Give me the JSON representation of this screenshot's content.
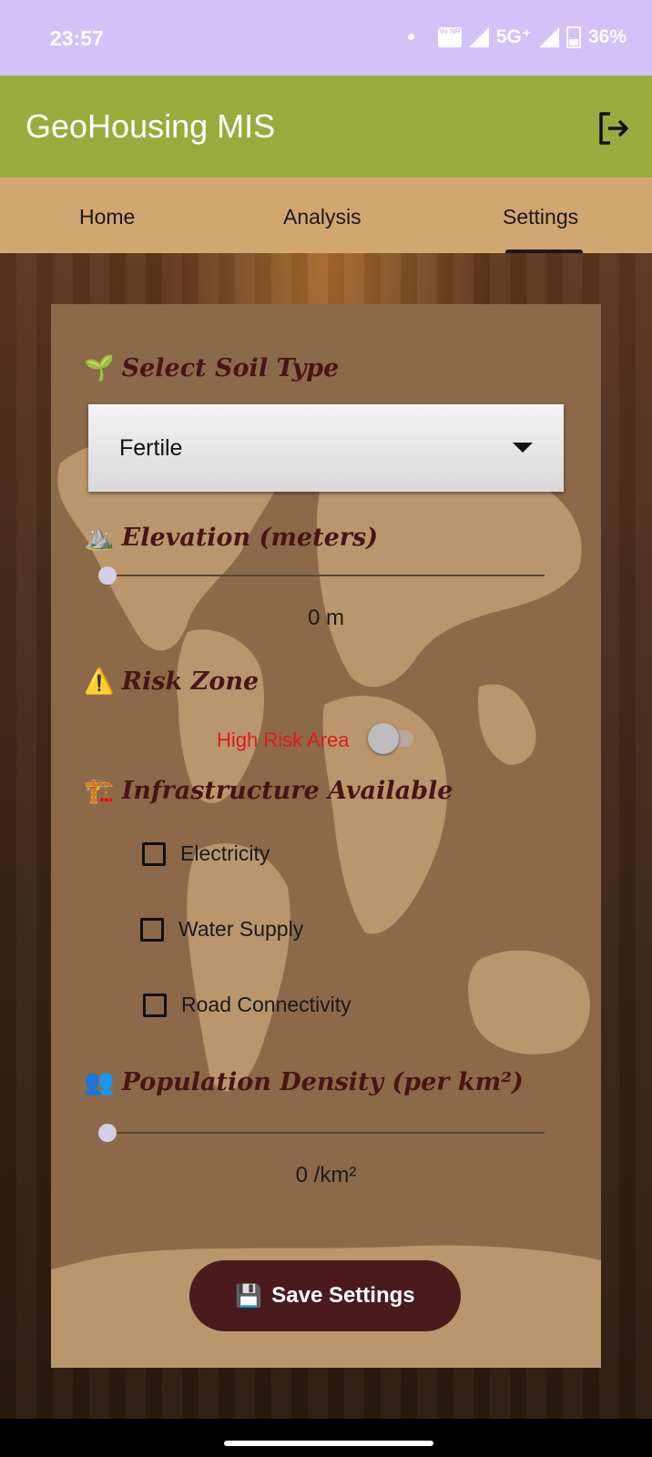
{
  "status": {
    "time": "23:57",
    "network": "5G⁺",
    "battery": "36%",
    "volte": "Vo NR"
  },
  "app": {
    "title": "GeoHousing MIS",
    "logout_icon": "logout-icon",
    "header_color": "#9aab3e"
  },
  "tabs": [
    {
      "label": "Home",
      "selected": false
    },
    {
      "label": "Analysis",
      "selected": false
    },
    {
      "label": "Settings",
      "selected": true
    }
  ],
  "form": {
    "soil": {
      "icon": "🌱",
      "title": "Select Soil Type",
      "value": "Fertile"
    },
    "elevation": {
      "icon": "⛰️",
      "title": "Elevation (meters)",
      "value": 0,
      "value_label": "0 m"
    },
    "risk": {
      "icon": "⚠️",
      "title": "Risk Zone",
      "switch_label": "High Risk Area",
      "checked": false
    },
    "infrastructure": {
      "icon": "🏗️",
      "title": "Infrastructure Available",
      "options": [
        {
          "label": "Electricity",
          "checked": false
        },
        {
          "label": "Water Supply",
          "checked": false
        },
        {
          "label": "Road Connectivity",
          "checked": false
        }
      ]
    },
    "population": {
      "icon": "👥",
      "title": "Population Density (per km²)",
      "value": 0,
      "value_label": "0 /km²"
    },
    "save": {
      "icon": "💾",
      "label": "Save Settings"
    }
  },
  "colors": {
    "accent_dark": "#4a1a1c",
    "title_text": "#4a1414",
    "risk_text": "#e01a1a"
  }
}
